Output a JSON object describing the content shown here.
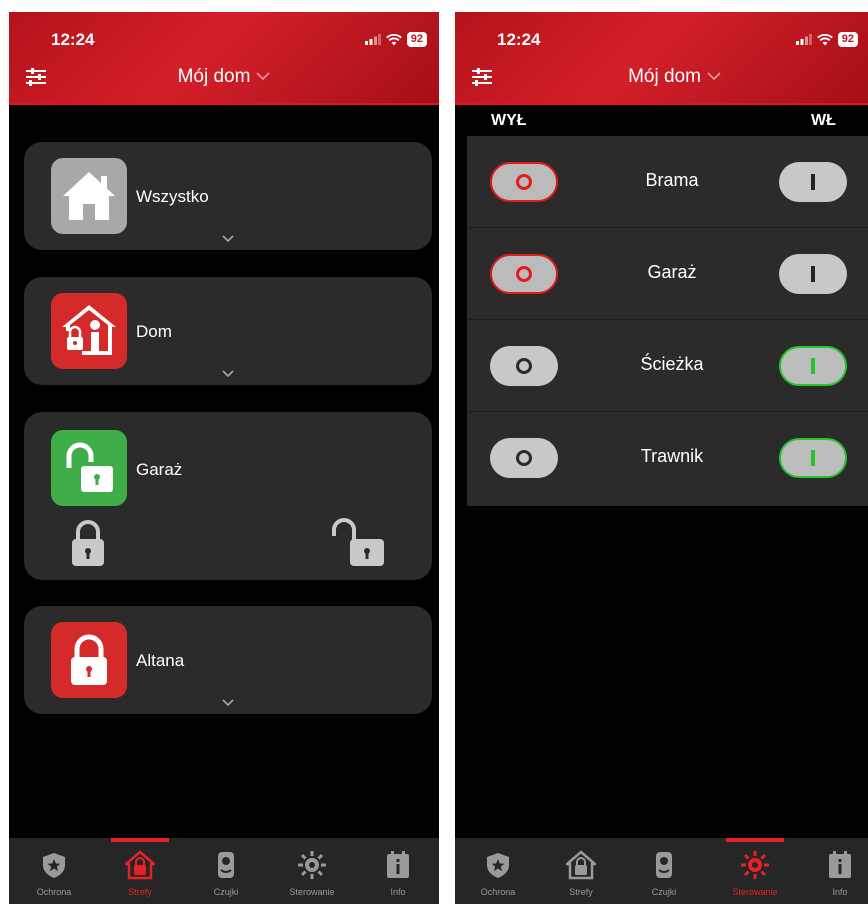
{
  "colors": {
    "accent": "#e8202a",
    "on_green": "#27c42b",
    "card": "#2b2b2b",
    "header_red": "#c4161f"
  },
  "status": {
    "time": "12:24",
    "battery": "92"
  },
  "header": {
    "home_title": "Mój dom"
  },
  "zones": [
    {
      "label": "Wszystko",
      "icon": "house-icon",
      "color": "#a8a8a8"
    },
    {
      "label": "Dom",
      "icon": "person-lock-icon",
      "color": "#d42a2a"
    },
    {
      "label": "Garaż",
      "icon": "unlocked-padlock-icon",
      "color": "#3fae49"
    },
    {
      "label": "Altana",
      "icon": "locked-padlock-icon",
      "color": "#d42a2a"
    }
  ],
  "control": {
    "off_header": "WYŁ",
    "on_header": "WŁ",
    "items": [
      {
        "label": "Brama",
        "state": "off"
      },
      {
        "label": "Garaż",
        "state": "off"
      },
      {
        "label": "Ścieżka",
        "state": "on"
      },
      {
        "label": "Trawnik",
        "state": "on"
      }
    ]
  },
  "tabs": [
    {
      "label": "Ochrona",
      "icon": "shield-star-icon"
    },
    {
      "label": "Strefy",
      "icon": "house-lock-icon"
    },
    {
      "label": "Czujki",
      "icon": "motion-sensor-icon"
    },
    {
      "label": "Sterowanie",
      "icon": "gear-sun-icon"
    },
    {
      "label": "Info",
      "icon": "info-board-icon"
    }
  ],
  "left_active_tab": "Strefy",
  "right_active_tab": "Sterowanie"
}
